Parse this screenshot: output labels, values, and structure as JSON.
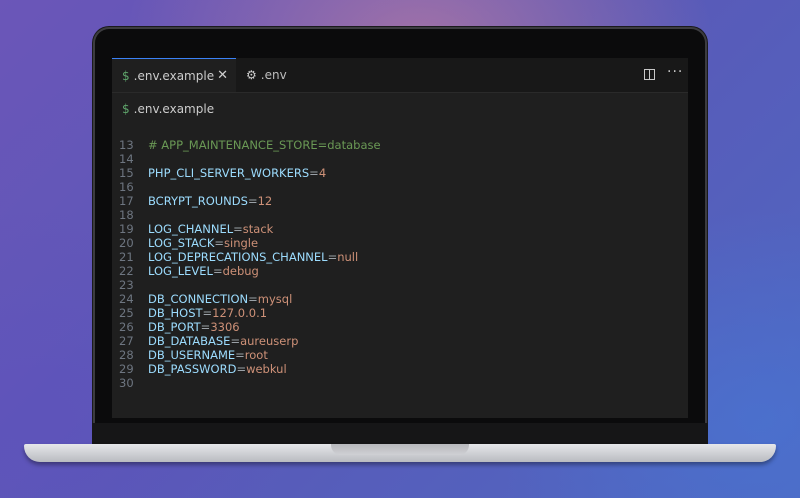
{
  "editor": {
    "tabs": [
      {
        "label": ".env.example",
        "icon": "dollar-icon",
        "active": true
      },
      {
        "label": ".env",
        "icon": "gear-icon",
        "active": false
      }
    ],
    "breadcrumb": ".env.example",
    "icons": {
      "split": "split-editor-icon",
      "more": "more-actions-icon",
      "close": "close-icon"
    },
    "colors": {
      "comment": "#6a9955",
      "key": "#9cdcfe",
      "value": "#ce9178",
      "line_number": "#6e7681",
      "background": "#1f1f1f"
    },
    "lines": [
      {
        "n": "13",
        "comment": "# APP_MAINTENANCE_STORE=database"
      },
      {
        "n": "14"
      },
      {
        "n": "15",
        "key": "PHP_CLI_SERVER_WORKERS",
        "value": "4"
      },
      {
        "n": "16"
      },
      {
        "n": "17",
        "key": "BCRYPT_ROUNDS",
        "value": "12"
      },
      {
        "n": "18"
      },
      {
        "n": "19",
        "key": "LOG_CHANNEL",
        "value": "stack"
      },
      {
        "n": "20",
        "key": "LOG_STACK",
        "value": "single"
      },
      {
        "n": "21",
        "key": "LOG_DEPRECATIONS_CHANNEL",
        "value": "null"
      },
      {
        "n": "22",
        "key": "LOG_LEVEL",
        "value": "debug"
      },
      {
        "n": "23"
      },
      {
        "n": "24",
        "key": "DB_CONNECTION",
        "value": "mysql"
      },
      {
        "n": "25",
        "key": "DB_HOST",
        "value": "127.0.0.1"
      },
      {
        "n": "26",
        "key": "DB_PORT",
        "value": "3306"
      },
      {
        "n": "27",
        "key": "DB_DATABASE",
        "value": "aureuserp"
      },
      {
        "n": "28",
        "key": "DB_USERNAME",
        "value": "root"
      },
      {
        "n": "29",
        "key": "DB_PASSWORD",
        "value": "webkul"
      },
      {
        "n": "30"
      }
    ]
  }
}
